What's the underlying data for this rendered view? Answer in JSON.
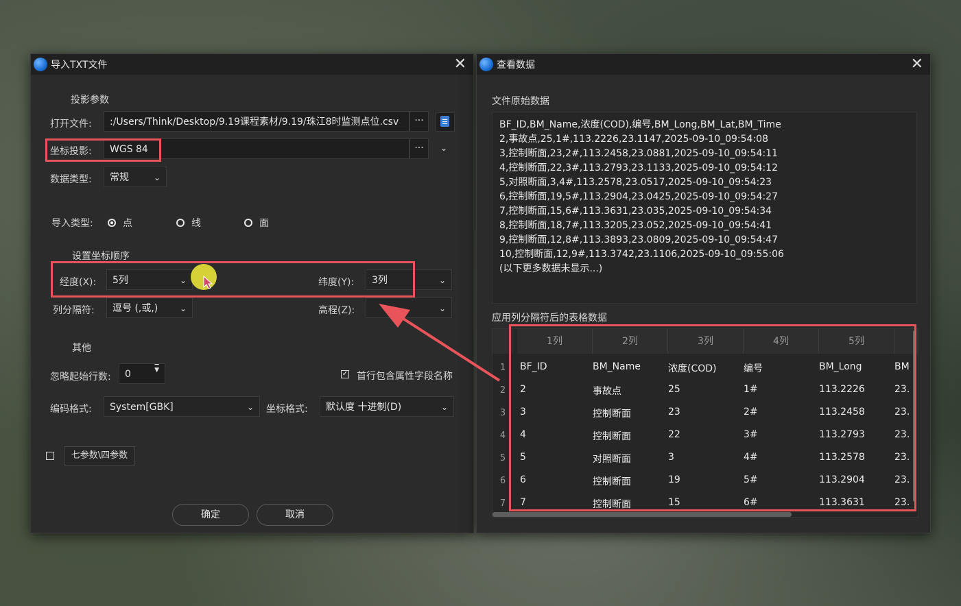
{
  "left_window": {
    "title": "导入TXT文件",
    "section_projection": "投影参数",
    "open_file_label": "打开文件:",
    "open_file_value": ":/Users/Think/Desktop/9.19课程素材/9.19/珠江8时监测点位.csv",
    "browse_label": "···",
    "coord_proj_label": "坐标投影:",
    "coord_proj_value": "WGS 84",
    "data_type_label": "数据类型:",
    "data_type_value": "常规",
    "import_type_label": "导入类型:",
    "import_types": [
      {
        "label": "点",
        "checked": true
      },
      {
        "label": "线",
        "checked": false
      },
      {
        "label": "面",
        "checked": false
      }
    ],
    "section_coord_order": "设置坐标顺序",
    "longitude_label": "经度(X):",
    "longitude_value": "5列",
    "latitude_label": "纬度(Y):",
    "latitude_value": "3列",
    "separator_label": "列分隔符:",
    "separator_value": "逗号 (,或,)",
    "elevation_label": "高程(Z):",
    "elevation_value": "",
    "section_other": "其他",
    "skip_rows_label": "忽略起始行数:",
    "skip_rows_value": "0",
    "first_row_header_label": "首行包含属性字段名称",
    "first_row_header_checked": true,
    "encoding_label": "编码格式:",
    "encoding_value": "System[GBK]",
    "coord_format_label": "坐标格式:",
    "coord_format_value": "默认度 十进制(D)",
    "seven_param_label": "七参数\\四参数",
    "seven_param_checked": false,
    "ok_label": "确定",
    "cancel_label": "取消"
  },
  "right_window": {
    "title": "查看数据",
    "raw_section_label": "文件原始数据",
    "raw_lines": [
      "BF_ID,BM_Name,浓度(COD),编号,BM_Long,BM_Lat,BM_Time",
      "2,事故点,25,1#,113.2226,23.1147,2025-09-10_09:54:08",
      "3,控制断面,23,2#,113.2458,23.0881,2025-09-10_09:54:11",
      "4,控制断面,22,3#,113.2793,23.1133,2025-09-10_09:54:12",
      "5,对照断面,3,4#,113.2578,23.0517,2025-09-10_09:54:23",
      "6,控制断面,19,5#,113.2904,23.0425,2025-09-10_09:54:27",
      "7,控制断面,15,6#,113.3631,23.035,2025-09-10_09:54:34",
      "8,控制断面,18,7#,113.3205,23.052,2025-09-10_09:54:41",
      "9,控制断面,12,8#,113.3893,23.0809,2025-09-10_09:54:47",
      "10,控制断面,12,9#,113.3742,23.1106,2025-09-10_09:55:06",
      "(以下更多数据未显示...)"
    ],
    "table_section_label": "应用列分隔符后的表格数据",
    "columns": [
      "1列",
      "2列",
      "3列",
      "4列",
      "5列",
      ""
    ],
    "rows": [
      [
        "1",
        "BF_ID",
        "BM_Name",
        "浓度(COD)",
        "编号",
        "BM_Long",
        "BM"
      ],
      [
        "2",
        "2",
        "事故点",
        "25",
        "1#",
        "113.2226",
        "23."
      ],
      [
        "3",
        "3",
        "控制断面",
        "23",
        "2#",
        "113.2458",
        "23."
      ],
      [
        "4",
        "4",
        "控制断面",
        "22",
        "3#",
        "113.2793",
        "23."
      ],
      [
        "5",
        "5",
        "对照断面",
        "3",
        "4#",
        "113.2578",
        "23."
      ],
      [
        "6",
        "6",
        "控制断面",
        "19",
        "5#",
        "113.2904",
        "23."
      ],
      [
        "7",
        "7",
        "控制断面",
        "15",
        "6#",
        "113.3631",
        "23."
      ]
    ]
  },
  "colors": {
    "highlight_red": "#e8545a",
    "window_bg": "#2b2b2b",
    "cursor_yellow": "#e6df3a"
  }
}
